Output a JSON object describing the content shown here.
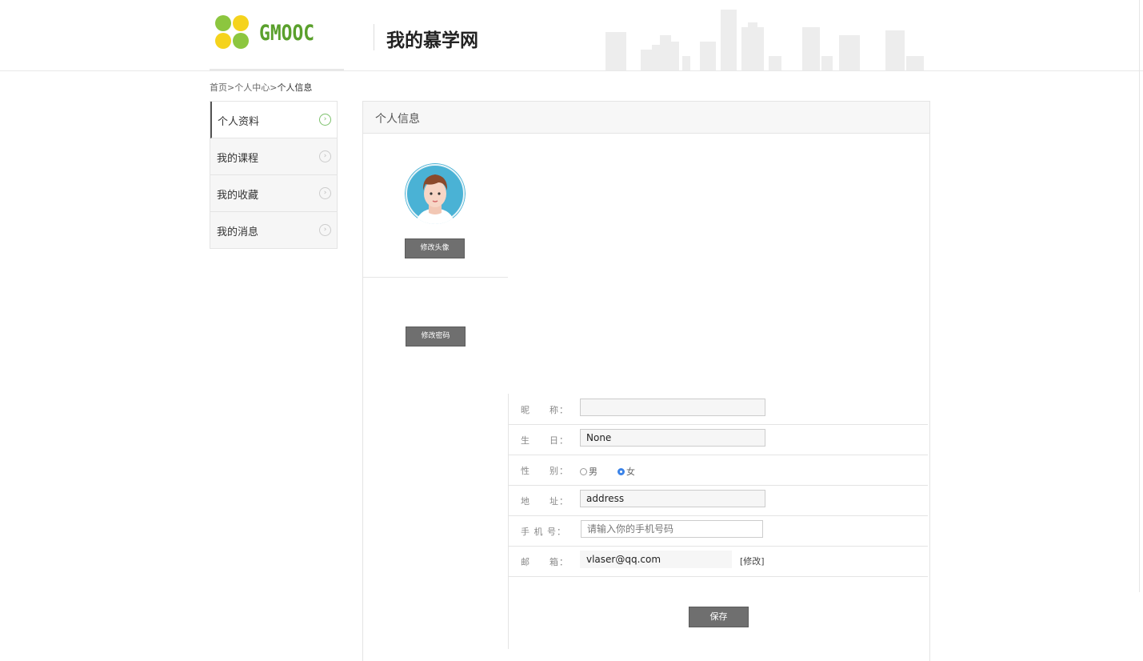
{
  "header": {
    "logo_text": "GMOOC",
    "site_title": "我的慕学网"
  },
  "breadcrumb": {
    "home": "首页",
    "sep1": ">",
    "center": "个人中心",
    "sep2": ">",
    "current": "个人信息"
  },
  "sidebar": {
    "items": [
      {
        "label": "个人资料",
        "active": true
      },
      {
        "label": "我的课程",
        "active": false
      },
      {
        "label": "我的收藏",
        "active": false
      },
      {
        "label": "我的消息",
        "active": false
      }
    ],
    "arrow": "›"
  },
  "panel": {
    "title": "个人信息",
    "avatar_button": "修改头像",
    "password_button": "修改密码"
  },
  "form": {
    "nickname": {
      "label": "昵　　称：",
      "value": ""
    },
    "birthday": {
      "label": "生　　日：",
      "value": "None"
    },
    "gender": {
      "label": "性　　别：",
      "options": [
        "男",
        "女"
      ],
      "selected": "女"
    },
    "address": {
      "label": "地　　址：",
      "value": "address"
    },
    "mobile": {
      "label": "手 机 号：",
      "placeholder": "请输入你的手机号码"
    },
    "email": {
      "label": "邮　　箱：",
      "value": "vlaser@qq.com",
      "modify": "[修改]"
    },
    "save": "保存"
  },
  "colors": {
    "brand_green": "#5aa02c",
    "logo_yellow": "#f5d31d",
    "button_gray": "#6f6f6f",
    "avatar_bg": "#4ab2d5",
    "radio_active": "#3b83e8"
  }
}
